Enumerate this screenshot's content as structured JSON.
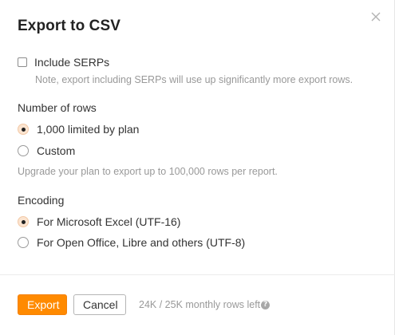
{
  "dialog": {
    "title": "Export to CSV"
  },
  "serps": {
    "label": "Include SERPs",
    "checked": false,
    "note": "Note, export including SERPs will use up significantly more export rows."
  },
  "rows": {
    "label": "Number of rows",
    "options": [
      {
        "label": "1,000 limited by plan",
        "selected": true
      },
      {
        "label": "Custom",
        "selected": false
      }
    ],
    "upgrade_note": "Upgrade your plan to export up to 100,000 rows per report."
  },
  "encoding": {
    "label": "Encoding",
    "options": [
      {
        "label": "For Microsoft Excel (UTF-16)",
        "selected": true
      },
      {
        "label": "For Open Office, Libre and others (UTF-8)",
        "selected": false
      }
    ]
  },
  "footer": {
    "export_label": "Export",
    "cancel_label": "Cancel",
    "rows_left": "24K / 25K monthly rows left",
    "help_glyph": "?"
  },
  "icons": {
    "close": "close-icon",
    "help": "question-circle-icon"
  },
  "colors": {
    "accent": "#ff8a00",
    "radio_selected_bg": "#fbe4d0",
    "muted_text": "#999999"
  }
}
